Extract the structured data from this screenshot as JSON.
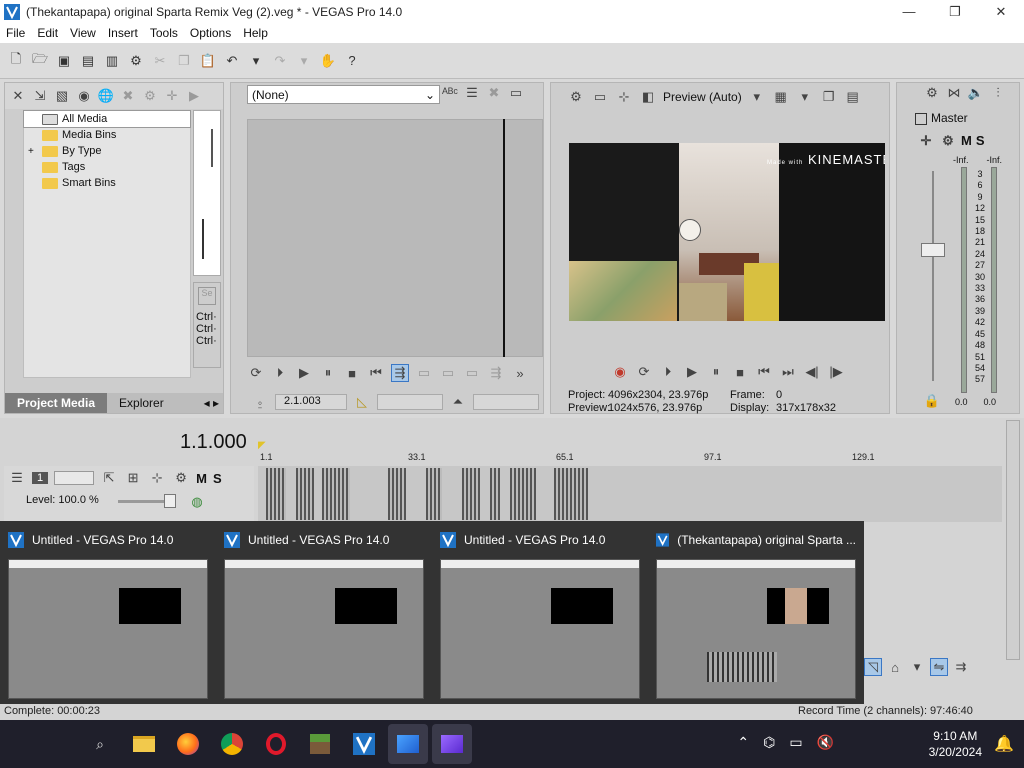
{
  "window": {
    "title": "(Thekantapapa) original Sparta Remix Veg (2).veg * - VEGAS Pro 14.0",
    "controls": [
      "—",
      "❐",
      "✕"
    ]
  },
  "menu": [
    "File",
    "Edit",
    "View",
    "Insert",
    "Tools",
    "Options",
    "Help"
  ],
  "project_media": {
    "tree": [
      {
        "label": "All Media",
        "selected": true,
        "expander": ""
      },
      {
        "label": "Media Bins",
        "selected": false,
        "expander": ""
      },
      {
        "label": "By Type",
        "selected": false,
        "expander": "+"
      },
      {
        "label": "Tags",
        "selected": false,
        "expander": ""
      },
      {
        "label": "Smart Bins",
        "selected": false,
        "expander": ""
      }
    ],
    "side_labels": [
      "Ctrl·",
      "Ctrl·",
      "Ctrl·"
    ],
    "tabs": [
      "Project Media",
      "Explorer"
    ]
  },
  "trimmer": {
    "select_value": "(None)",
    "timecode": "2.1.003"
  },
  "preview": {
    "quality": "Preview (Auto)",
    "watermark": "KINEMASTER",
    "watermark_prefix": "Made with",
    "project_label": "Project:",
    "project_value": "4096x2304, 23.976p",
    "preview_label": "Preview:",
    "preview_value": "1024x576, 23.976p",
    "frame_label": "Frame:",
    "frame_value": "0",
    "display_label": "Display:",
    "display_value": "317x178x32"
  },
  "master": {
    "label": "Master",
    "m": "M",
    "s": "S",
    "inf_left": "-Inf.",
    "inf_right": "-Inf.",
    "scale": [
      "3",
      "6",
      "9",
      "12",
      "15",
      "18",
      "21",
      "24",
      "27",
      "30",
      "33",
      "36",
      "39",
      "42",
      "45",
      "48",
      "51",
      "54",
      "57"
    ],
    "bottom_left": "0.0",
    "bottom_right": "0.0"
  },
  "timeline": {
    "time": "1.1.000",
    "ruler": [
      "1.1",
      "33.1",
      "65.1",
      "97.1",
      "129.1"
    ],
    "track_number": "1",
    "level_label": "Level: 100.0 %",
    "m": "M",
    "s": "S"
  },
  "task_previews": [
    {
      "title": "Untitled - VEGAS Pro 14.0"
    },
    {
      "title": "Untitled - VEGAS Pro 14.0"
    },
    {
      "title": "Untitled - VEGAS Pro 14.0"
    },
    {
      "title": "(Thekantapapa) original Sparta ..."
    }
  ],
  "status": {
    "left": "Complete: 00:00:23",
    "right": "Record Time (2 channels): 97:46:40"
  },
  "taskbar": {
    "time": "9:10 AM",
    "date": "3/20/2024"
  },
  "colors": {
    "accent": "#1f72c4",
    "taskbar_bg": "#1f1f2b",
    "preview_bg": "#333333",
    "folder": "#f2c94c"
  }
}
